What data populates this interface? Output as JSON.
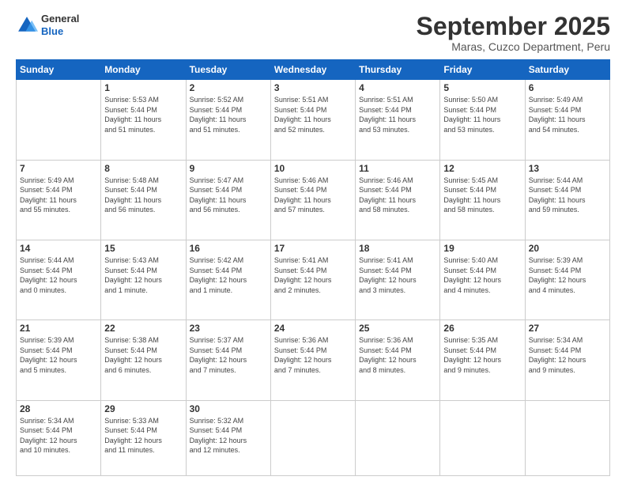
{
  "logo": {
    "line1": "General",
    "line2": "Blue"
  },
  "title": "September 2025",
  "subtitle": "Maras, Cuzco Department, Peru",
  "weekdays": [
    "Sunday",
    "Monday",
    "Tuesday",
    "Wednesday",
    "Thursday",
    "Friday",
    "Saturday"
  ],
  "weeks": [
    [
      {
        "day": "",
        "info": ""
      },
      {
        "day": "1",
        "info": "Sunrise: 5:53 AM\nSunset: 5:44 PM\nDaylight: 11 hours\nand 51 minutes."
      },
      {
        "day": "2",
        "info": "Sunrise: 5:52 AM\nSunset: 5:44 PM\nDaylight: 11 hours\nand 51 minutes."
      },
      {
        "day": "3",
        "info": "Sunrise: 5:51 AM\nSunset: 5:44 PM\nDaylight: 11 hours\nand 52 minutes."
      },
      {
        "day": "4",
        "info": "Sunrise: 5:51 AM\nSunset: 5:44 PM\nDaylight: 11 hours\nand 53 minutes."
      },
      {
        "day": "5",
        "info": "Sunrise: 5:50 AM\nSunset: 5:44 PM\nDaylight: 11 hours\nand 53 minutes."
      },
      {
        "day": "6",
        "info": "Sunrise: 5:49 AM\nSunset: 5:44 PM\nDaylight: 11 hours\nand 54 minutes."
      }
    ],
    [
      {
        "day": "7",
        "info": "Sunrise: 5:49 AM\nSunset: 5:44 PM\nDaylight: 11 hours\nand 55 minutes."
      },
      {
        "day": "8",
        "info": "Sunrise: 5:48 AM\nSunset: 5:44 PM\nDaylight: 11 hours\nand 56 minutes."
      },
      {
        "day": "9",
        "info": "Sunrise: 5:47 AM\nSunset: 5:44 PM\nDaylight: 11 hours\nand 56 minutes."
      },
      {
        "day": "10",
        "info": "Sunrise: 5:46 AM\nSunset: 5:44 PM\nDaylight: 11 hours\nand 57 minutes."
      },
      {
        "day": "11",
        "info": "Sunrise: 5:46 AM\nSunset: 5:44 PM\nDaylight: 11 hours\nand 58 minutes."
      },
      {
        "day": "12",
        "info": "Sunrise: 5:45 AM\nSunset: 5:44 PM\nDaylight: 11 hours\nand 58 minutes."
      },
      {
        "day": "13",
        "info": "Sunrise: 5:44 AM\nSunset: 5:44 PM\nDaylight: 11 hours\nand 59 minutes."
      }
    ],
    [
      {
        "day": "14",
        "info": "Sunrise: 5:44 AM\nSunset: 5:44 PM\nDaylight: 12 hours\nand 0 minutes."
      },
      {
        "day": "15",
        "info": "Sunrise: 5:43 AM\nSunset: 5:44 PM\nDaylight: 12 hours\nand 1 minute."
      },
      {
        "day": "16",
        "info": "Sunrise: 5:42 AM\nSunset: 5:44 PM\nDaylight: 12 hours\nand 1 minute."
      },
      {
        "day": "17",
        "info": "Sunrise: 5:41 AM\nSunset: 5:44 PM\nDaylight: 12 hours\nand 2 minutes."
      },
      {
        "day": "18",
        "info": "Sunrise: 5:41 AM\nSunset: 5:44 PM\nDaylight: 12 hours\nand 3 minutes."
      },
      {
        "day": "19",
        "info": "Sunrise: 5:40 AM\nSunset: 5:44 PM\nDaylight: 12 hours\nand 4 minutes."
      },
      {
        "day": "20",
        "info": "Sunrise: 5:39 AM\nSunset: 5:44 PM\nDaylight: 12 hours\nand 4 minutes."
      }
    ],
    [
      {
        "day": "21",
        "info": "Sunrise: 5:39 AM\nSunset: 5:44 PM\nDaylight: 12 hours\nand 5 minutes."
      },
      {
        "day": "22",
        "info": "Sunrise: 5:38 AM\nSunset: 5:44 PM\nDaylight: 12 hours\nand 6 minutes."
      },
      {
        "day": "23",
        "info": "Sunrise: 5:37 AM\nSunset: 5:44 PM\nDaylight: 12 hours\nand 7 minutes."
      },
      {
        "day": "24",
        "info": "Sunrise: 5:36 AM\nSunset: 5:44 PM\nDaylight: 12 hours\nand 7 minutes."
      },
      {
        "day": "25",
        "info": "Sunrise: 5:36 AM\nSunset: 5:44 PM\nDaylight: 12 hours\nand 8 minutes."
      },
      {
        "day": "26",
        "info": "Sunrise: 5:35 AM\nSunset: 5:44 PM\nDaylight: 12 hours\nand 9 minutes."
      },
      {
        "day": "27",
        "info": "Sunrise: 5:34 AM\nSunset: 5:44 PM\nDaylight: 12 hours\nand 9 minutes."
      }
    ],
    [
      {
        "day": "28",
        "info": "Sunrise: 5:34 AM\nSunset: 5:44 PM\nDaylight: 12 hours\nand 10 minutes."
      },
      {
        "day": "29",
        "info": "Sunrise: 5:33 AM\nSunset: 5:44 PM\nDaylight: 12 hours\nand 11 minutes."
      },
      {
        "day": "30",
        "info": "Sunrise: 5:32 AM\nSunset: 5:44 PM\nDaylight: 12 hours\nand 12 minutes."
      },
      {
        "day": "",
        "info": ""
      },
      {
        "day": "",
        "info": ""
      },
      {
        "day": "",
        "info": ""
      },
      {
        "day": "",
        "info": ""
      }
    ]
  ]
}
